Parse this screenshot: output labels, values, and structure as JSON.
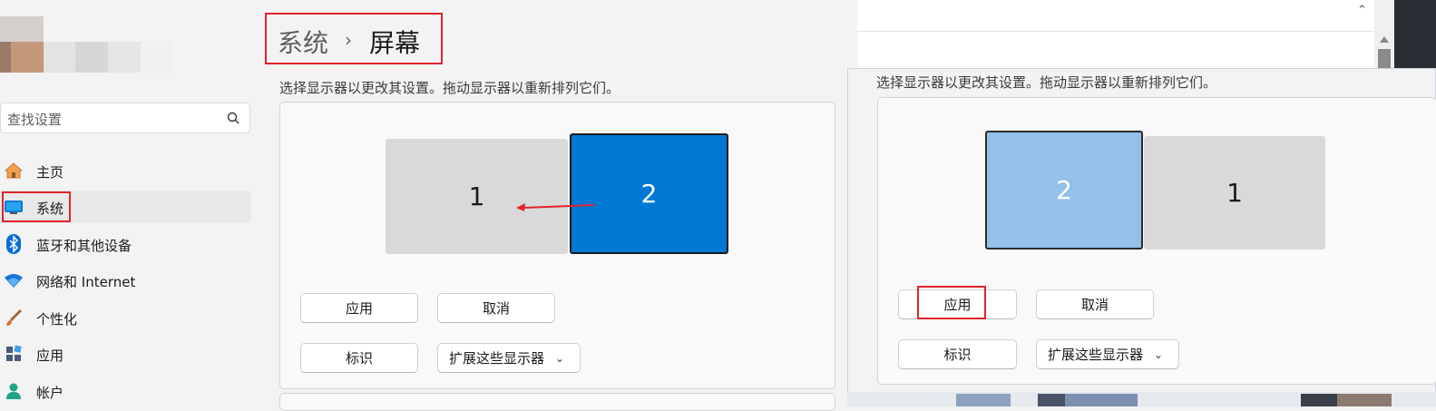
{
  "sidebar": {
    "search_placeholder": "查找设置",
    "items": [
      {
        "label": "主页",
        "icon": "home-icon"
      },
      {
        "label": "系统",
        "icon": "system-display-icon"
      },
      {
        "label": "蓝牙和其他设备",
        "icon": "bluetooth-icon"
      },
      {
        "label": "网络和 Internet",
        "icon": "wifi-icon"
      },
      {
        "label": "个性化",
        "icon": "brush-icon"
      },
      {
        "label": "应用",
        "icon": "apps-icon"
      },
      {
        "label": "帐户",
        "icon": "account-icon"
      }
    ],
    "active_index": 1
  },
  "header": {
    "breadcrumb_parent": "系统",
    "breadcrumb_separator": "›",
    "title": "屏幕"
  },
  "main": {
    "instruction": "选择显示器以更改其设置。拖动显示器以重新排列它们。",
    "monitors": [
      {
        "label": "1"
      },
      {
        "label": "2"
      }
    ],
    "apply_label": "应用",
    "cancel_label": "取消",
    "identify_label": "标识",
    "mode_value": "扩展这些显示器"
  },
  "popup": {
    "instruction": "选择显示器以更改其设置。拖动显示器以重新排列它们。",
    "monitors": [
      {
        "label": "2"
      },
      {
        "label": "1"
      }
    ],
    "apply_label": "应用",
    "cancel_label": "取消",
    "identify_label": "标识",
    "mode_value": "扩展这些显示器"
  },
  "colors": {
    "accent": "#0078d4",
    "selected_light": "#93c1e8",
    "highlight_red": "#e0242b",
    "arrow_red": "#e0242b"
  }
}
